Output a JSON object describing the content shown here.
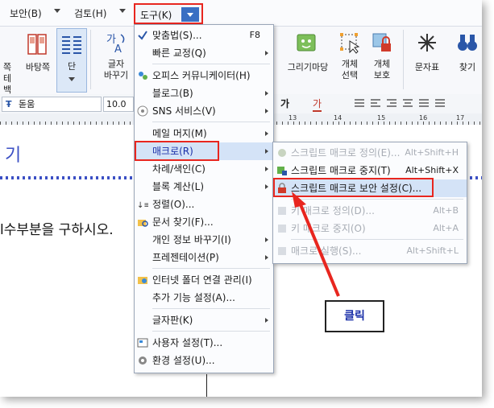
{
  "menubar": {
    "security": "보안(B)",
    "review": "검토(H)",
    "tools": "도구(K)"
  },
  "ribbon": {
    "partial_left": "쪽",
    "partial_left2": "테백",
    "background_page": "바탕쪽",
    "column": "단",
    "char_change1": "글자",
    "char_change2": "바꾸기",
    "drawing_market": "그리기마당",
    "object_select1": "개체",
    "object_select2": "선택",
    "object_protect1": "개체",
    "object_protect2": "보호",
    "char_table": "문자표",
    "find": "찾기"
  },
  "format": {
    "font": "돋움",
    "size_partial": "10.0",
    "char_label": "가",
    "ruler_marks": [
      "13",
      "14",
      "15",
      "16",
      "17"
    ]
  },
  "document": {
    "title_partial": "기",
    "body_text": "l수부분을 구하시오."
  },
  "tools_menu": {
    "items": [
      {
        "label": "맞춤법(S)...",
        "shortcut": "F8"
      },
      {
        "label": "빠른 교정(Q)"
      },
      {
        "label": "오피스 커뮤니케이터(H)"
      },
      {
        "label": "블로그(B)"
      },
      {
        "label": "SNS 서비스(V)"
      },
      {
        "label": "메일 머지(M)"
      },
      {
        "label": "매크로(R)"
      },
      {
        "label": "차례/색인(C)"
      },
      {
        "label": "블록 계산(L)"
      },
      {
        "label": "정렬(O)..."
      },
      {
        "label": "문서 찾기(F)..."
      },
      {
        "label": "개인 정보 바꾸기(I)"
      },
      {
        "label": "프레젠테이션(P)"
      },
      {
        "label": "인터넷 폴더 연결 관리(I)"
      },
      {
        "label": "추가 기능 설정(A)..."
      },
      {
        "label": "글자판(K)"
      },
      {
        "label": "사용자 설정(T)..."
      },
      {
        "label": "환경 설정(U)..."
      }
    ]
  },
  "macro_menu": {
    "items": [
      {
        "label": "스크립트 매크로 정의(E)...",
        "shortcut": "Alt+Shift+H"
      },
      {
        "label": "스크립트 매크로 중지(T)",
        "shortcut": "Alt+Shift+X"
      },
      {
        "label": "스크립트 매크로 보안 설정(C)..."
      },
      {
        "label": "키 매크로 정의(D)...",
        "shortcut": "Alt+B"
      },
      {
        "label": "키 매크로 중지(O)",
        "shortcut": "Alt+A"
      },
      {
        "label": "매크로 실행(S)...",
        "shortcut": "Alt+Shift+L"
      }
    ]
  },
  "callout": {
    "label": "클릭"
  },
  "colors": {
    "highlight_border": "#e8261f",
    "accent_blue": "#3a6fc3",
    "menu_highlight": "#d4e3f7"
  }
}
